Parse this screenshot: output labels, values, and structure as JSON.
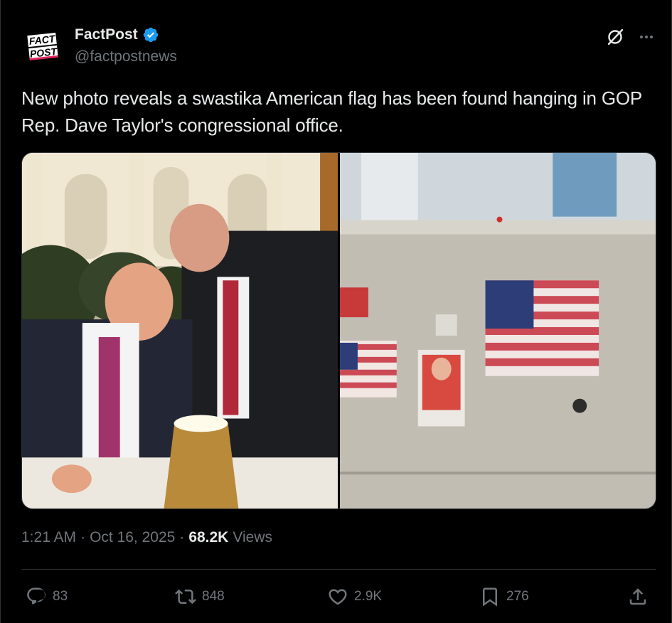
{
  "author": {
    "display_name": "FactPost",
    "handle": "@factpostnews",
    "avatar_text": [
      "FACT",
      "POST"
    ],
    "verified": true
  },
  "tweet": {
    "text": "New photo reveals a swastika American flag has been found hanging in GOP Rep. Dave Taylor's congressional office."
  },
  "meta": {
    "time": "1:21 AM",
    "separator": "·",
    "date": "Oct 16, 2025",
    "views_count": "68.2K",
    "views_label": "Views"
  },
  "actions": {
    "replies": "83",
    "reposts": "848",
    "likes": "2.9K",
    "bookmarks": "276"
  },
  "icons": {
    "header": [
      "grok-icon",
      "more-icon"
    ],
    "actions": [
      "reply-icon",
      "repost-icon",
      "like-icon",
      "bookmark-icon",
      "share-icon"
    ]
  },
  "colors": {
    "background": "#000000",
    "text_primary": "#e7e9ea",
    "text_secondary": "#71767b",
    "verified": "#1d9bf0",
    "divider": "#2f3336"
  }
}
